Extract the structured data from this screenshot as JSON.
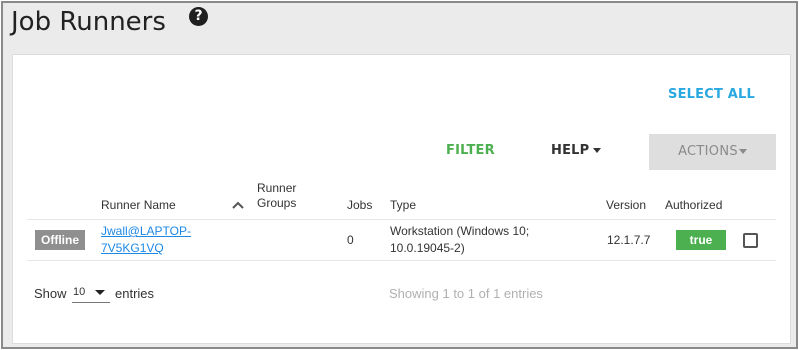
{
  "page": {
    "title": "Job Runners"
  },
  "toolbar": {
    "select_all_label": "SELECT ALL",
    "filter_label": "FILTER",
    "help_label": "HELP",
    "actions_label": "ACTIONS"
  },
  "table": {
    "columns": [
      "Runner Name",
      "Runner Groups",
      "Jobs",
      "Type",
      "Version",
      "Authorized"
    ],
    "column_runner_groups_line1": "Runner",
    "column_runner_groups_line2": "Groups",
    "rows": [
      {
        "status": "Offline",
        "name_line1": "Jwall@LAPTOP-",
        "name_line2": "7V5KG1VQ",
        "groups": "",
        "jobs": "0",
        "type_line1": "Workstation (Windows 10;",
        "type_line2": "10.0.19045-2)",
        "version": "12.1.7.7",
        "authorized": "true"
      }
    ]
  },
  "footer": {
    "show_label": "Show",
    "page_size": "10",
    "entries_label": "entries",
    "info": "Showing 1 to 1 of 1 entries"
  },
  "colors": {
    "accent_blue": "#29a9e0",
    "filter_green": "#4caf50",
    "authorized_green": "#4caf50",
    "offline_gray": "#8f8f8f"
  },
  "icons": {
    "help": "question-circle-icon",
    "sort": "chevron-up-icon",
    "caret": "caret-down-icon"
  }
}
